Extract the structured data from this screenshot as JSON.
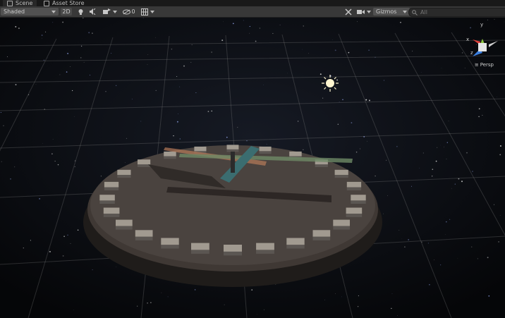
{
  "tabs": [
    {
      "label": "Scene",
      "icon": "scene-icon"
    },
    {
      "label": "Asset Store",
      "icon": "store-icon"
    }
  ],
  "toolbar": {
    "shading_mode": "Shaded",
    "mode_2d": "2D",
    "hidden_count": "0",
    "gizmos_label": "Gizmos",
    "search_placeholder": "All"
  },
  "viewport": {
    "projection_label": "Persp",
    "gizmo_axes": {
      "y": "y",
      "x": "x",
      "z": "z"
    }
  },
  "colors": {
    "toolbar": "#383838",
    "tabbar": "#191919",
    "x_axis": "#e0403a",
    "y_axis": "#8bc43f",
    "z_axis": "#3a7ee0"
  }
}
